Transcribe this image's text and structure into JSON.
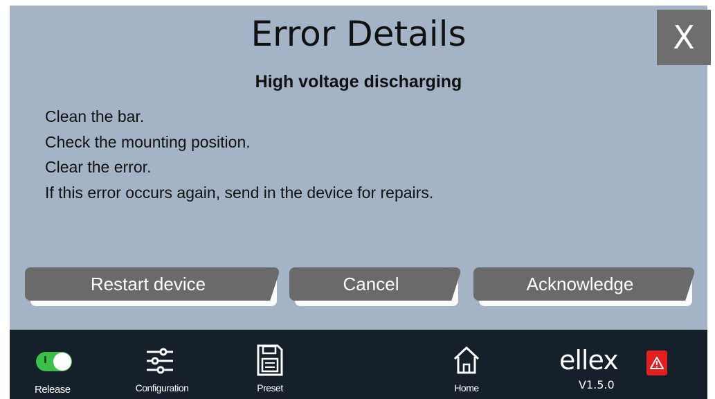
{
  "dialog": {
    "title": "Error Details",
    "close_label": "X",
    "subtitle": "High voltage discharging",
    "instructions": [
      "Clean the bar.",
      "Check the mounting position.",
      "Clear the error.",
      "If this error occurs again, send in the device for repairs."
    ],
    "buttons": {
      "restart": "Restart device",
      "cancel": "Cancel",
      "acknowledge": "Acknowledge"
    }
  },
  "taskbar": {
    "release_label": "Release",
    "release_toggle_mark": "I",
    "release_state": "on",
    "configuration_label": "Configuration",
    "preset_label": "Preset",
    "home_label": "Home",
    "version": "V1.5.0",
    "logo_text": "ellex",
    "icons": [
      "toggle-switch-icon",
      "sliders-icon",
      "floppy-disk-icon",
      "home-icon",
      "warning-icon"
    ]
  },
  "colors": {
    "dialog_bg": "#a4b4c6",
    "button_bg": "#6a6a6a",
    "taskbar_bg": "#16202b",
    "toggle_on": "#3bbf4a",
    "alarm": "#e02020"
  }
}
